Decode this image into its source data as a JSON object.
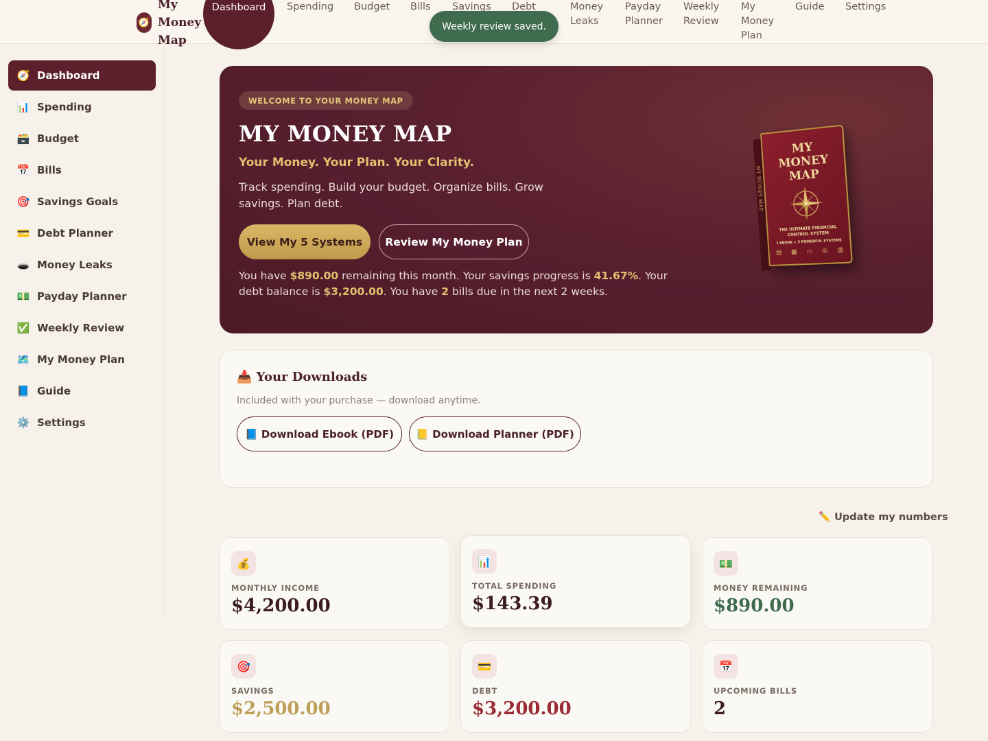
{
  "brand": {
    "name": "My Money Map",
    "icon": "compass-icon"
  },
  "topnav": {
    "items": [
      {
        "label": "Dashboard",
        "active": true
      },
      {
        "label": "Spending"
      },
      {
        "label": "Budget"
      },
      {
        "label": "Bills"
      },
      {
        "label": "Savings"
      },
      {
        "label": "Debt"
      },
      {
        "label": "Money Leaks"
      },
      {
        "label": "Payday Planner"
      },
      {
        "label": "Weekly Review"
      },
      {
        "label": "My Money Plan"
      },
      {
        "label": "Guide"
      },
      {
        "label": "Settings"
      }
    ]
  },
  "toast": {
    "message": "Weekly review saved."
  },
  "sidebar": {
    "items": [
      {
        "label": "Dashboard",
        "icon": "🧭",
        "active": true
      },
      {
        "label": "Spending",
        "icon": "📊"
      },
      {
        "label": "Budget",
        "icon": "🗃️"
      },
      {
        "label": "Bills",
        "icon": "📅"
      },
      {
        "label": "Savings Goals",
        "icon": "🎯"
      },
      {
        "label": "Debt Planner",
        "icon": "💳"
      },
      {
        "label": "Money Leaks",
        "icon": "🕳️"
      },
      {
        "label": "Payday Planner",
        "icon": "💵"
      },
      {
        "label": "Weekly Review",
        "icon": "✅"
      },
      {
        "label": "My Money Plan",
        "icon": "🗺️"
      },
      {
        "label": "Guide",
        "icon": "📘"
      },
      {
        "label": "Settings",
        "icon": "⚙️"
      }
    ]
  },
  "hero": {
    "badge": "WELCOME TO YOUR MONEY MAP",
    "title": "MY MONEY MAP",
    "subtitle": "Your Money. Your Plan. Your Clarity.",
    "description": "Track spending. Build your budget. Organize bills. Grow savings. Plan debt.",
    "primary_button": "View My 5 Systems",
    "secondary_button": "Review My Money Plan",
    "summary": {
      "p1": "You have ",
      "remaining": "$890.00",
      "p2": " remaining this month. Your savings progress is ",
      "savings_progress": "41.67%",
      "p3": ". Your debt balance is ",
      "debt_balance": "$3,200.00",
      "p4": ". You have ",
      "bills_due": "2",
      "p5": " bills due in the next 2 weeks."
    },
    "book": {
      "title_line1": "MY",
      "title_line2": "MONEY",
      "title_line3": "MAP",
      "spine": "MY MONEY MAP",
      "tagline1": "THE ULTIMATE FINANCIAL",
      "tagline2": "CONTROL SYSTEM",
      "tagline3": "1 EBOOK + 5 POWERFUL SYSTEMS"
    }
  },
  "downloads": {
    "title": "📥 Your Downloads",
    "subtitle": "Included with your purchase — download anytime.",
    "ebook_button": "📘 Download Ebook (PDF)",
    "planner_button": "📒 Download Planner (PDF)"
  },
  "update_link": "✏️ Update my numbers",
  "stats": [
    {
      "icon": "💰",
      "label": "MONTHLY INCOME",
      "value": "$4,200.00",
      "color": "#3b1c22"
    },
    {
      "icon": "📊",
      "label": "TOTAL SPENDING",
      "value": "$143.39",
      "color": "#3b1c22"
    },
    {
      "icon": "💵",
      "label": "MONEY REMAINING",
      "value": "$890.00",
      "color": "#3f6b4f"
    },
    {
      "icon": "🎯",
      "label": "SAVINGS",
      "value": "$2,500.00",
      "color": "#bfa05a"
    },
    {
      "icon": "💳",
      "label": "DEBT",
      "value": "$3,200.00",
      "color": "#9b2a35"
    },
    {
      "icon": "📅",
      "label": "UPCOMING BILLS",
      "value": "2",
      "color": "#3b1c22"
    }
  ],
  "colors": {
    "brand": "#5c1f2c",
    "gold": "#e2c070",
    "success": "#3f6b4f",
    "background": "#f6f1ea"
  }
}
